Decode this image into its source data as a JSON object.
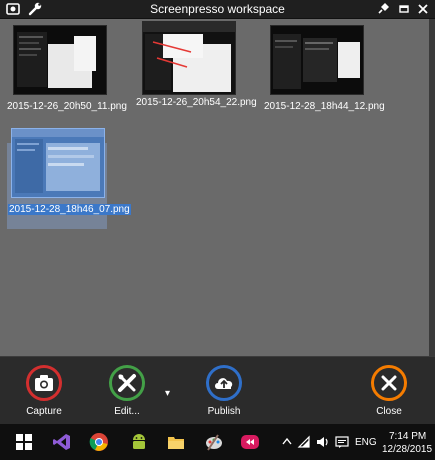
{
  "window": {
    "title": "Screenpresso workspace"
  },
  "icons": {
    "app": "screenpresso-app-icon",
    "tools": "wrench-icon",
    "pin": "pin-icon",
    "restore": "restore-icon",
    "close": "close-window-icon"
  },
  "thumbnails": [
    {
      "filename": "2015-12-26_20h50_11.png",
      "selected": false
    },
    {
      "filename": "2015-12-26_20h54_22.png",
      "selected": false
    },
    {
      "filename": "2015-12-28_18h44_12.png",
      "selected": false
    },
    {
      "filename": "2015-12-28_18h46_07.png",
      "selected": true
    }
  ],
  "actions": {
    "capture": {
      "label": "Capture",
      "color": "#d32f2f"
    },
    "edit": {
      "label": "Edit...",
      "color": "#43a047"
    },
    "publish": {
      "label": "Publish",
      "color": "#2f6fc9"
    },
    "close": {
      "label": "Close",
      "color": "#f57c00"
    },
    "dropdown": "▾"
  },
  "taskbar": {
    "language": "ENG",
    "time": "7:14 PM",
    "date": "12/28/2015",
    "apps": [
      "windows-start-icon",
      "visual-studio-icon",
      "chrome-icon",
      "android-icon",
      "file-explorer-icon",
      "paint-icon",
      "screenpresso-icon"
    ],
    "tray": [
      "chevron-up-icon",
      "wifi-icon",
      "volume-icon",
      "action-center-icon"
    ]
  }
}
